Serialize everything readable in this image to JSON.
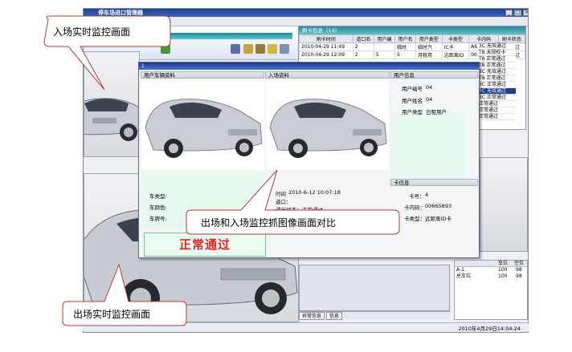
{
  "app": {
    "title": "停车场进口管理器",
    "menu_fragment": "置"
  },
  "record_panel": {
    "title": "刷卡信息（14）",
    "columns": [
      "刷卡时间",
      "道口名",
      "用户编",
      "用户名",
      "用户类型",
      "卡类型",
      "卡内码",
      "刷卡状态"
    ],
    "rows": [
      [
        "2010-04-29 11:49",
        "2",
        "",
        "临时",
        "临时汽",
        "IC卡",
        "A6BF6ED",
        "正常通过"
      ],
      [
        "2010-04-29 12:09",
        "2",
        "5",
        "5",
        "月租用",
        "远距离ID",
        "00663IC",
        "正常通过"
      ]
    ],
    "side_status": [
      {
        "code": "3C",
        "status": "无效通过"
      },
      {
        "code": "T8",
        "status": "未授权卡"
      },
      {
        "code": "T8",
        "status": "正常通过"
      },
      {
        "code": "T8",
        "status": "正常通过"
      },
      {
        "code": "3C",
        "status": "无效通过"
      },
      {
        "code": "T8",
        "status": "正常通过"
      },
      {
        "code": "3C",
        "status": "正常通过"
      },
      {
        "code": "3C",
        "status": "无效通过"
      },
      {
        "code": "3C",
        "status": "正常通过"
      },
      {
        "code": "",
        "status": "正常通过"
      },
      {
        "code": "",
        "status": "正常通过"
      },
      {
        "code": "",
        "status": "正常通过"
      }
    ]
  },
  "dialog": {
    "title": "1",
    "vehicle_section": "用户车辆资料",
    "entry_section": "入场资料",
    "user_section": "用户信息",
    "user_no_label": "用户编号",
    "user_no": "04",
    "user_name_label": "用户姓名",
    "user_name": "04",
    "user_type_label": "用户类型",
    "user_type": "日租用户",
    "car_type_label": "车类型:",
    "car_color_label": "车颜色:",
    "plate_label": "车牌号:",
    "time_label": "时间",
    "time_value": "2010-6-12 10:07:18",
    "gate_label": "道口：",
    "pass_status_label": "通行状态：",
    "pass_status_value": "正常通过",
    "card_section": "卡信息",
    "card_no_label": "卡号：",
    "card_no": "4",
    "card_code_label": "卡内码：",
    "card_code": "00665893",
    "card_type_label": "卡类型：",
    "card_type": "远距离ID卡",
    "pass_banner": "正常通过"
  },
  "bottom": {
    "tab_abnormal": "异常信息",
    "tab_info": "信息",
    "lot_columns": [
      "",
      "车位",
      "空位"
    ],
    "lots": [
      {
        "name": "A-1",
        "spaces": "100",
        "free": "98"
      },
      {
        "name": "总车位",
        "spaces": "100",
        "free": "98"
      }
    ],
    "datetime": "2010年4月29日14:04:24"
  },
  "callouts": {
    "entry_live": "入场实时监控画面",
    "compare": "出场和入场监控抓图像画面对比",
    "exit_live": "出场实时监控画面"
  },
  "colors": {
    "title_blue": "#1d3f8c",
    "teal_header": "#2b8a96",
    "pass_red": "#e02020",
    "pass_bg": "#e9fbef"
  }
}
